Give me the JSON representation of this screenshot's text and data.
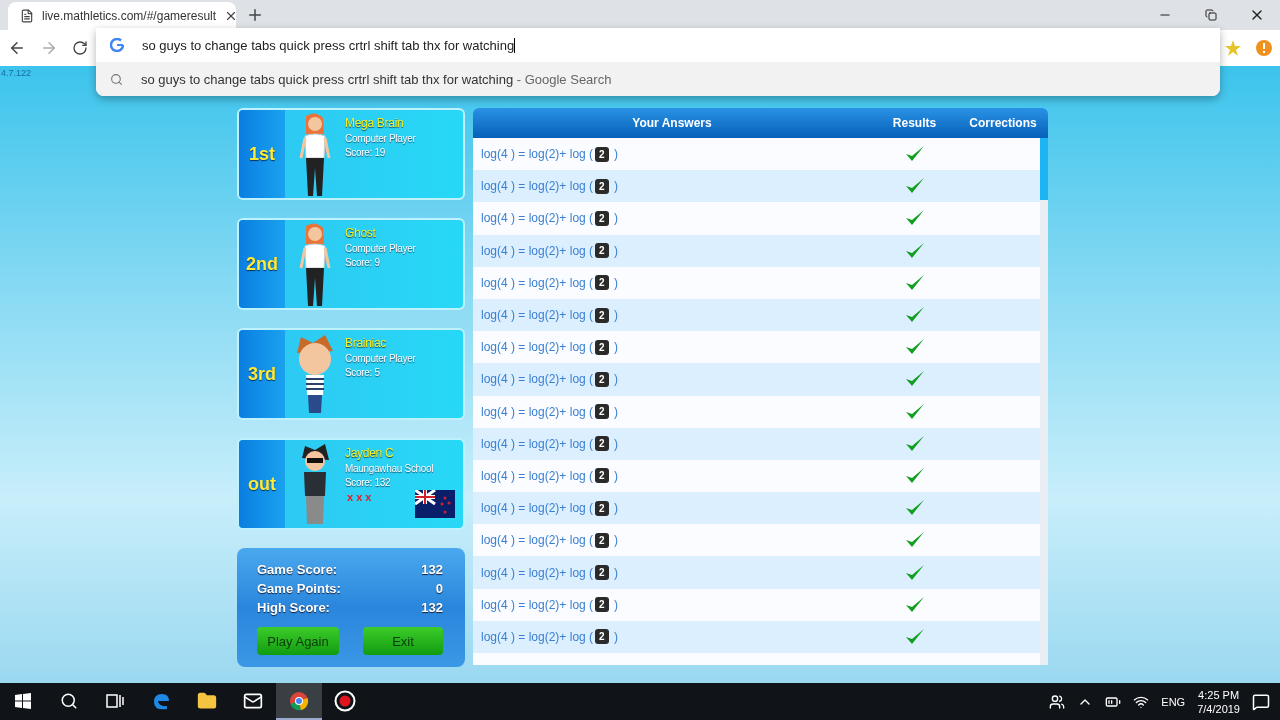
{
  "browser": {
    "tab": {
      "title": "live.mathletics.com/#/gameresult"
    },
    "omnibox": {
      "value": "so guys to change tabs quick press crtrl shift tab thx for watching"
    },
    "suggestions": [
      {
        "text": "so guys to change tabs quick press crtrl shift tab thx for watching",
        "source": " - Google Search"
      }
    ]
  },
  "version": "4.7.122",
  "players": [
    {
      "rank": "1st",
      "name": "Mega Brain",
      "subtitle": "Computer Player",
      "score": "Score: 19",
      "kind": "woman",
      "flag": false
    },
    {
      "rank": "2nd",
      "name": "Ghost",
      "subtitle": "Computer Player",
      "score": "Score: 9",
      "kind": "woman",
      "flag": false
    },
    {
      "rank": "3rd",
      "name": "Brainiac",
      "subtitle": "Computer Player",
      "score": "Score: 5",
      "kind": "boy",
      "flag": false
    },
    {
      "rank": "out",
      "name": "Jayden C",
      "subtitle": "Maungawhau School",
      "score": "Score: 132",
      "kind": "teen",
      "strikes": "x x x",
      "flag": true
    }
  ],
  "summary": {
    "rows": [
      {
        "label": "Game Score:",
        "value": "132"
      },
      {
        "label": "Game Points:",
        "value": "0"
      },
      {
        "label": "High Score:",
        "value": "132"
      }
    ],
    "buttons": [
      "Play Again",
      "Exit"
    ]
  },
  "answers": {
    "columns": [
      "Your Answers",
      "Results",
      "Corrections"
    ],
    "rows": [
      {
        "before": "log(4 ) = log(2)+ log (",
        "value": "2",
        "after": " )",
        "correct": true
      },
      {
        "before": "log(4 ) = log(2)+ log (",
        "value": "2",
        "after": " )",
        "correct": true
      },
      {
        "before": "log(4 ) = log(2)+ log (",
        "value": "2",
        "after": " )",
        "correct": true
      },
      {
        "before": "log(4 ) = log(2)+ log (",
        "value": "2",
        "after": " )",
        "correct": true
      },
      {
        "before": "log(4 ) = log(2)+ log (",
        "value": "2",
        "after": " )",
        "correct": true
      },
      {
        "before": "log(4 ) = log(2)+ log (",
        "value": "2",
        "after": " )",
        "correct": true
      },
      {
        "before": "log(4 ) = log(2)+ log (",
        "value": "2",
        "after": " )",
        "correct": true
      },
      {
        "before": "log(4 ) = log(2)+ log (",
        "value": "2",
        "after": " )",
        "correct": true
      },
      {
        "before": "log(4 ) = log(2)+ log (",
        "value": "2",
        "after": " )",
        "correct": true
      },
      {
        "before": "log(4 ) = log(2)+ log (",
        "value": "2",
        "after": " )",
        "correct": true
      },
      {
        "before": "log(4 ) = log(2)+ log (",
        "value": "2",
        "after": " )",
        "correct": true
      },
      {
        "before": "log(4 ) = log(2)+ log (",
        "value": "2",
        "after": " )",
        "correct": true
      },
      {
        "before": "log(4 ) = log(2)+ log (",
        "value": "2",
        "after": " )",
        "correct": true
      },
      {
        "before": "log(4 ) = log(2)+ log (",
        "value": "2",
        "after": " )",
        "correct": true
      },
      {
        "before": "log(4 ) = log(2)+ log (",
        "value": "2",
        "after": " )",
        "correct": true
      },
      {
        "before": "log(4 ) = log(2)+ log (",
        "value": "2",
        "after": " )",
        "correct": true
      }
    ]
  },
  "taskbar": {
    "apps": [
      {
        "kind": "edge",
        "selected": false
      },
      {
        "kind": "folder",
        "selected": false
      },
      {
        "kind": "mail",
        "selected": false
      },
      {
        "kind": "chrome",
        "selected": true
      },
      {
        "kind": "record",
        "selected": false
      }
    ],
    "language": "ENG",
    "time": "4:25 PM",
    "date": "7/4/2019"
  }
}
